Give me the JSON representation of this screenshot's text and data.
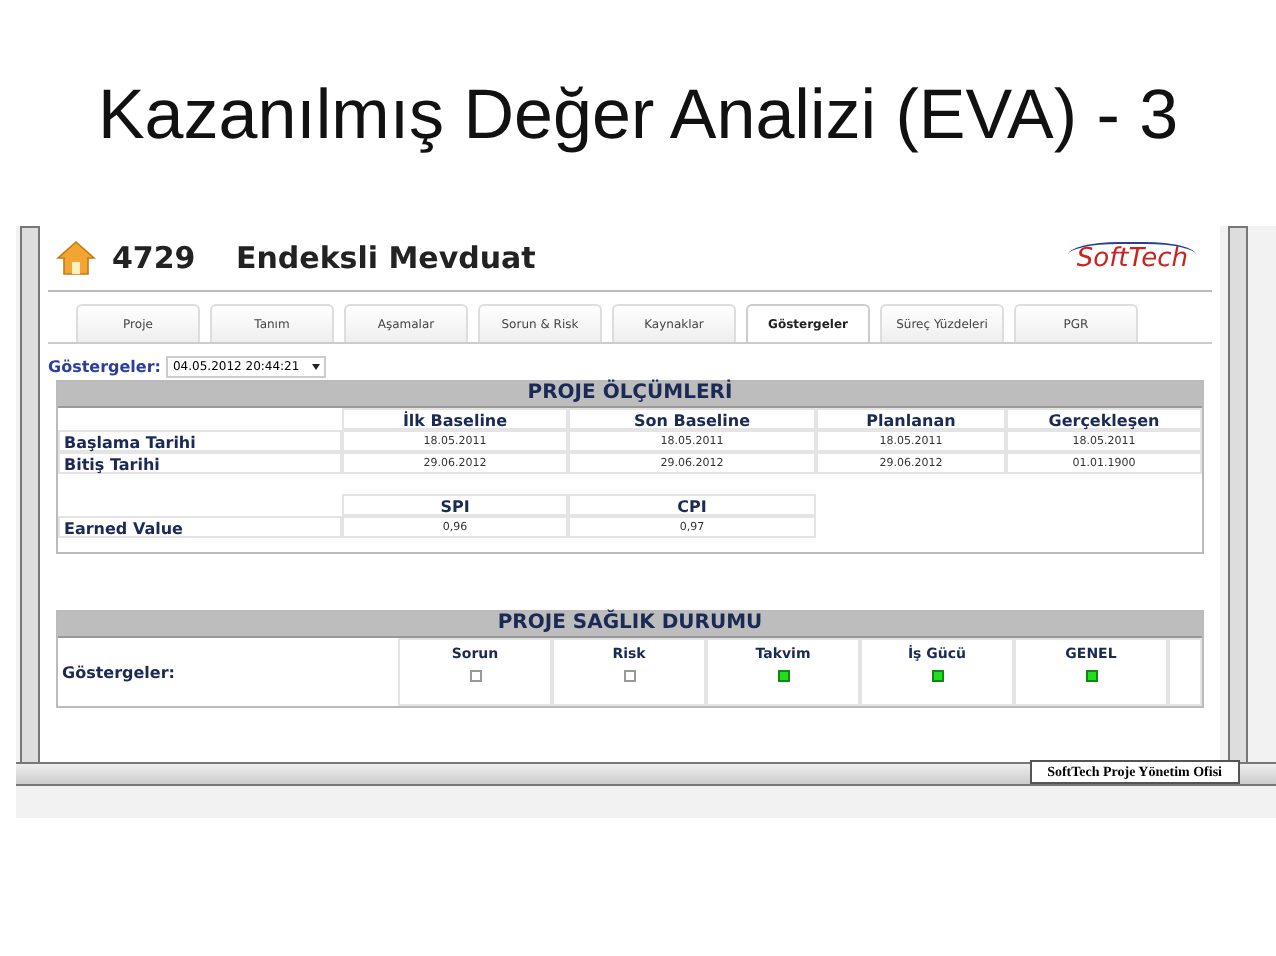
{
  "slide_title": "Kazanılmış Değer Analizi (EVA) - 3",
  "header": {
    "project_no": "4729",
    "project_name": "Endeksli Mevduat",
    "logo": "SoftTech"
  },
  "tabs": [
    {
      "label": "Proje",
      "selected": false
    },
    {
      "label": "Tanım",
      "selected": false
    },
    {
      "label": "Aşamalar",
      "selected": false
    },
    {
      "label": "Sorun & Risk",
      "selected": false
    },
    {
      "label": "Kaynaklar",
      "selected": false
    },
    {
      "label": "Göstergeler",
      "selected": true
    },
    {
      "label": "Süreç Yüzdeleri",
      "selected": false
    },
    {
      "label": "PGR",
      "selected": false
    }
  ],
  "filter": {
    "label": "Göstergeler:",
    "value": "04.05.2012 20:44:21"
  },
  "measurements": {
    "title": "PROJE ÖLÇÜMLERİ",
    "columns": [
      "İlk Baseline",
      "Son Baseline",
      "Planlanan",
      "Gerçekleşen"
    ],
    "rows": [
      {
        "label": "Başlama Tarihi",
        "cells": [
          "18.05.2011",
          "18.05.2011",
          "18.05.2011",
          "18.05.2011"
        ]
      },
      {
        "label": "Bitiş Tarihi",
        "cells": [
          "29.06.2012",
          "29.06.2012",
          "29.06.2012",
          "01.01.1900"
        ]
      }
    ],
    "index_columns": [
      "SPI",
      "CPI"
    ],
    "index_rows": [
      {
        "label": "Earned Value",
        "cells": [
          "0,96",
          "0,97"
        ]
      }
    ]
  },
  "health": {
    "title": "PROJE SAĞLIK DURUMU",
    "label": "Göstergeler:",
    "indicators": [
      {
        "name": "Sorun",
        "lit": false
      },
      {
        "name": "Risk",
        "lit": false
      },
      {
        "name": "Takvim",
        "lit": true
      },
      {
        "name": "İş Gücü",
        "lit": true
      },
      {
        "name": "GENEL",
        "lit": true
      }
    ]
  },
  "footer": {
    "text": "SoftTech Proje Yönetim Ofisi"
  }
}
